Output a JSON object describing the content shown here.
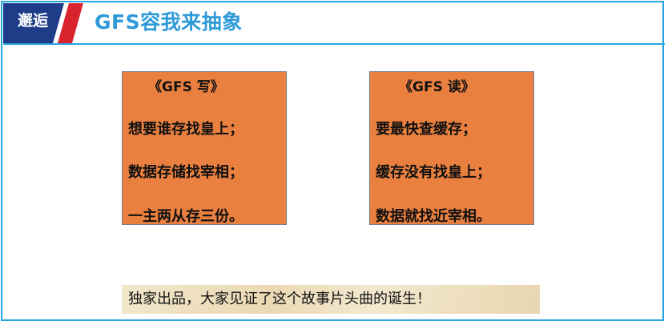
{
  "header": {
    "badge": "邂逅",
    "title": "GFS容我来抽象",
    "colors": {
      "badge_bg": "#1f3c88",
      "accent_red": "#d9232e",
      "title": "#2f9ad8",
      "border": "#29a3e0"
    }
  },
  "poems": [
    {
      "title": "《GFS 写》",
      "lines": [
        "想要谁存找皇上；",
        "数据存储找宰相；",
        "一主两从存三份。"
      ]
    },
    {
      "title": "《GFS  读》",
      "lines": [
        "要最快查缓存；",
        "缓存没有找皇上；",
        "数据就找近宰相。"
      ]
    }
  ],
  "poem_card_color": "#ea803f",
  "banner": {
    "text": "独家出品，大家见证了这个故事片头曲的诞生！"
  }
}
